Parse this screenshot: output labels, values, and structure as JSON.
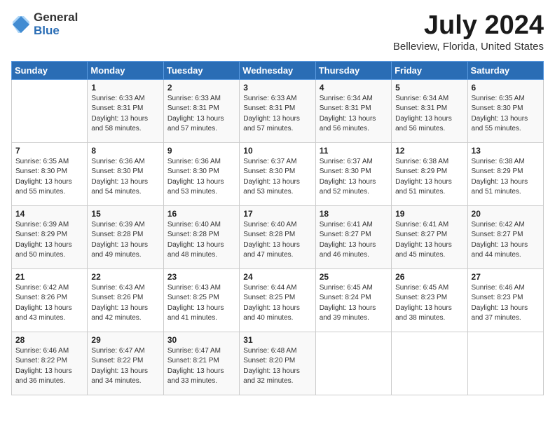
{
  "logo": {
    "text_general": "General",
    "text_blue": "Blue"
  },
  "title": {
    "month_year": "July 2024",
    "location": "Belleview, Florida, United States"
  },
  "days_of_week": [
    "Sunday",
    "Monday",
    "Tuesday",
    "Wednesday",
    "Thursday",
    "Friday",
    "Saturday"
  ],
  "weeks": [
    [
      {
        "day": "",
        "content": ""
      },
      {
        "day": "1",
        "content": "Sunrise: 6:33 AM\nSunset: 8:31 PM\nDaylight: 13 hours\nand 58 minutes."
      },
      {
        "day": "2",
        "content": "Sunrise: 6:33 AM\nSunset: 8:31 PM\nDaylight: 13 hours\nand 57 minutes."
      },
      {
        "day": "3",
        "content": "Sunrise: 6:33 AM\nSunset: 8:31 PM\nDaylight: 13 hours\nand 57 minutes."
      },
      {
        "day": "4",
        "content": "Sunrise: 6:34 AM\nSunset: 8:31 PM\nDaylight: 13 hours\nand 56 minutes."
      },
      {
        "day": "5",
        "content": "Sunrise: 6:34 AM\nSunset: 8:31 PM\nDaylight: 13 hours\nand 56 minutes."
      },
      {
        "day": "6",
        "content": "Sunrise: 6:35 AM\nSunset: 8:30 PM\nDaylight: 13 hours\nand 55 minutes."
      }
    ],
    [
      {
        "day": "7",
        "content": "Sunrise: 6:35 AM\nSunset: 8:30 PM\nDaylight: 13 hours\nand 55 minutes."
      },
      {
        "day": "8",
        "content": "Sunrise: 6:36 AM\nSunset: 8:30 PM\nDaylight: 13 hours\nand 54 minutes."
      },
      {
        "day": "9",
        "content": "Sunrise: 6:36 AM\nSunset: 8:30 PM\nDaylight: 13 hours\nand 53 minutes."
      },
      {
        "day": "10",
        "content": "Sunrise: 6:37 AM\nSunset: 8:30 PM\nDaylight: 13 hours\nand 53 minutes."
      },
      {
        "day": "11",
        "content": "Sunrise: 6:37 AM\nSunset: 8:30 PM\nDaylight: 13 hours\nand 52 minutes."
      },
      {
        "day": "12",
        "content": "Sunrise: 6:38 AM\nSunset: 8:29 PM\nDaylight: 13 hours\nand 51 minutes."
      },
      {
        "day": "13",
        "content": "Sunrise: 6:38 AM\nSunset: 8:29 PM\nDaylight: 13 hours\nand 51 minutes."
      }
    ],
    [
      {
        "day": "14",
        "content": "Sunrise: 6:39 AM\nSunset: 8:29 PM\nDaylight: 13 hours\nand 50 minutes."
      },
      {
        "day": "15",
        "content": "Sunrise: 6:39 AM\nSunset: 8:28 PM\nDaylight: 13 hours\nand 49 minutes."
      },
      {
        "day": "16",
        "content": "Sunrise: 6:40 AM\nSunset: 8:28 PM\nDaylight: 13 hours\nand 48 minutes."
      },
      {
        "day": "17",
        "content": "Sunrise: 6:40 AM\nSunset: 8:28 PM\nDaylight: 13 hours\nand 47 minutes."
      },
      {
        "day": "18",
        "content": "Sunrise: 6:41 AM\nSunset: 8:27 PM\nDaylight: 13 hours\nand 46 minutes."
      },
      {
        "day": "19",
        "content": "Sunrise: 6:41 AM\nSunset: 8:27 PM\nDaylight: 13 hours\nand 45 minutes."
      },
      {
        "day": "20",
        "content": "Sunrise: 6:42 AM\nSunset: 8:27 PM\nDaylight: 13 hours\nand 44 minutes."
      }
    ],
    [
      {
        "day": "21",
        "content": "Sunrise: 6:42 AM\nSunset: 8:26 PM\nDaylight: 13 hours\nand 43 minutes."
      },
      {
        "day": "22",
        "content": "Sunrise: 6:43 AM\nSunset: 8:26 PM\nDaylight: 13 hours\nand 42 minutes."
      },
      {
        "day": "23",
        "content": "Sunrise: 6:43 AM\nSunset: 8:25 PM\nDaylight: 13 hours\nand 41 minutes."
      },
      {
        "day": "24",
        "content": "Sunrise: 6:44 AM\nSunset: 8:25 PM\nDaylight: 13 hours\nand 40 minutes."
      },
      {
        "day": "25",
        "content": "Sunrise: 6:45 AM\nSunset: 8:24 PM\nDaylight: 13 hours\nand 39 minutes."
      },
      {
        "day": "26",
        "content": "Sunrise: 6:45 AM\nSunset: 8:23 PM\nDaylight: 13 hours\nand 38 minutes."
      },
      {
        "day": "27",
        "content": "Sunrise: 6:46 AM\nSunset: 8:23 PM\nDaylight: 13 hours\nand 37 minutes."
      }
    ],
    [
      {
        "day": "28",
        "content": "Sunrise: 6:46 AM\nSunset: 8:22 PM\nDaylight: 13 hours\nand 36 minutes."
      },
      {
        "day": "29",
        "content": "Sunrise: 6:47 AM\nSunset: 8:22 PM\nDaylight: 13 hours\nand 34 minutes."
      },
      {
        "day": "30",
        "content": "Sunrise: 6:47 AM\nSunset: 8:21 PM\nDaylight: 13 hours\nand 33 minutes."
      },
      {
        "day": "31",
        "content": "Sunrise: 6:48 AM\nSunset: 8:20 PM\nDaylight: 13 hours\nand 32 minutes."
      },
      {
        "day": "",
        "content": ""
      },
      {
        "day": "",
        "content": ""
      },
      {
        "day": "",
        "content": ""
      }
    ]
  ]
}
